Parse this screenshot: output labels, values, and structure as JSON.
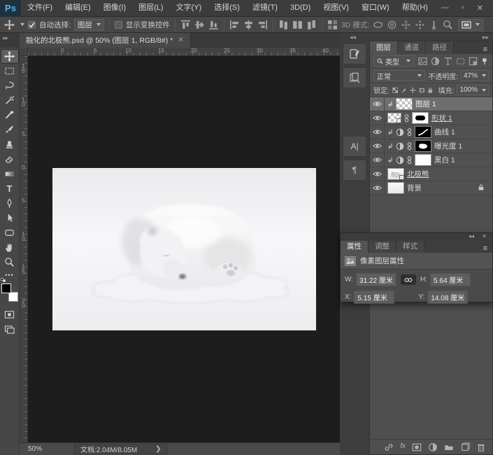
{
  "app": {
    "logo": "Ps"
  },
  "window": {
    "minimize": "—",
    "maximize": "▫",
    "close": "✕"
  },
  "menu_bar": {
    "items": [
      "文件(F)",
      "编辑(E)",
      "图像(I)",
      "图层(L)",
      "文字(Y)",
      "选择(S)",
      "滤镜(T)",
      "3D(D)",
      "视图(V)",
      "窗口(W)",
      "帮助(H)"
    ]
  },
  "options_bar": {
    "auto_select_label": "自动选择:",
    "auto_select_value": "图层",
    "show_transform_label": "显示变换控件",
    "mode_3d_label": "3D 模式:"
  },
  "document": {
    "tab_title": "融化的北极熊.psd @ 50% (图层 1, RGB/8#) *",
    "close_glyph": "✕",
    "zoom_level": "50%",
    "doc_size": "文档:2.04M/8.05M",
    "arrow_glyph": "❯"
  },
  "rulers": {
    "horizontal": [
      "0",
      "5",
      "10",
      "15",
      "20",
      "25",
      "30",
      "35",
      "40"
    ],
    "vertical": [
      "15",
      "10",
      "5",
      "0",
      "5",
      "10",
      "15",
      "20"
    ]
  },
  "tools": [
    "move",
    "marquee",
    "lasso",
    "quick-select",
    "eyedropper",
    "brush",
    "clone-stamp",
    "eraser",
    "gradient",
    "type",
    "pen",
    "path-select",
    "shape",
    "hand",
    "zoom"
  ],
  "icons": {
    "type_tool": "T",
    "more_tools": "•••",
    "panel_menu": "≡",
    "character": "A|",
    "paragraph": "¶",
    "collapse_left": "◂◂",
    "collapse_right": "▸▸",
    "fx": "fx"
  },
  "layers_panel": {
    "tabs": [
      "图层",
      "通道",
      "路径"
    ],
    "filter_value": "类型",
    "blend_mode_value": "正常",
    "opacity_label": "不透明度:",
    "opacity_value": "47%",
    "lock_label": "锁定:",
    "fill_label": "填充:",
    "fill_value": "100%",
    "layers": [
      {
        "name": "图层 1"
      },
      {
        "name": "形状 1"
      },
      {
        "name": "曲线 1"
      },
      {
        "name": "曝光度 1"
      },
      {
        "name": "黑白 1"
      },
      {
        "name": "北极熊"
      },
      {
        "name": "背景"
      }
    ]
  },
  "properties_panel": {
    "tabs": [
      "属性",
      "调整",
      "样式"
    ],
    "header": "像素图层属性",
    "w_label": "W:",
    "w_value": "31.22 厘米",
    "h_label": "H:",
    "h_value": "5.64 厘米",
    "x_label": "X:",
    "x_value": "5.15 厘米",
    "y_label": "Y:",
    "y_value": "14.08 厘米"
  },
  "colors": {
    "accent_blue": "#5ab4f0",
    "canvas_bg": "#1d1d1d",
    "panel_bg": "#4f4f4f",
    "selected_row": "#6e6e6e"
  }
}
